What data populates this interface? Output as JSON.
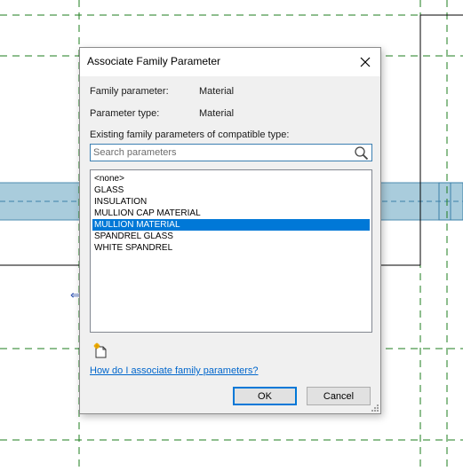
{
  "dialog": {
    "title": "Associate Family Parameter",
    "close_label": "✕",
    "family_parameter_label": "Family parameter:",
    "family_parameter_value": "Material",
    "parameter_type_label": "Parameter type:",
    "parameter_type_value": "Material",
    "existing_label": "Existing family parameters of compatible type:",
    "search": {
      "placeholder": "Search parameters",
      "value": ""
    },
    "parameters": [
      {
        "label": "<none>",
        "selected": false
      },
      {
        "label": "GLASS",
        "selected": false
      },
      {
        "label": "INSULATION",
        "selected": false
      },
      {
        "label": "MULLION CAP MATERIAL",
        "selected": false
      },
      {
        "label": "MULLION MATERIAL",
        "selected": true
      },
      {
        "label": "SPANDREL GLASS",
        "selected": false
      },
      {
        "label": "WHITE SPANDREL",
        "selected": false
      }
    ],
    "help_link": "How do I associate family parameters?",
    "ok_label": "OK",
    "cancel_label": "Cancel"
  },
  "background": {
    "arrow_glyph": "⇐",
    "colors": {
      "grid_line": "#1e7d1e",
      "band_fill": "#a9ccdc",
      "band_line": "#3a7fa8",
      "selection": "#0078d7"
    }
  }
}
